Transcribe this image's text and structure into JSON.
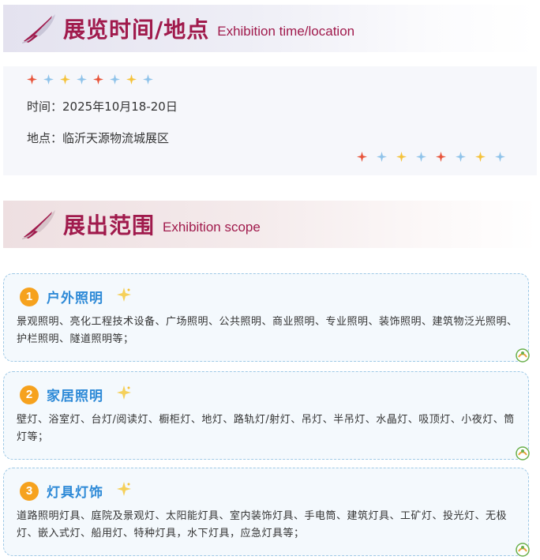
{
  "section1": {
    "title": "展览时间/地点",
    "subtitle": "Exhibition time/location"
  },
  "info": {
    "time": "时间：2025年10月18-20日",
    "place": "地点：临沂天源物流城展区"
  },
  "section2": {
    "title": "展出范围",
    "subtitle": "Exhibition scope"
  },
  "cards": [
    {
      "number": "1",
      "title": "户外照明",
      "body": "景观照明、亮化工程技术设备、广场照明、公共照明、商业照明、专业照明、装饰照明、建筑物泛光照明、护栏照明、隧道照明等；"
    },
    {
      "number": "2",
      "title": "家居照明",
      "body": "壁灯、浴室灯、台灯/阅读灯、橱柜灯、地灯、路轨灯/射灯、吊灯、半吊灯、水晶灯、吸顶灯、小夜灯、筒灯等；"
    },
    {
      "number": "3",
      "title": "灯具灯饰",
      "body": "道路照明灯具、庭院及景观灯、太阳能灯具、室内装饰灯具、手电筒、建筑灯具、工矿灯、投光灯、无极灯、嵌入式灯、船用灯、特种灯具，水下灯具，应急灯具等；"
    }
  ],
  "colors": {
    "title_red": "#a01a4c",
    "card_blue": "#2e8ad7",
    "badge_orange": "#f6a21e",
    "spark_red": "#e8543a",
    "spark_blue": "#8fc3ea",
    "spark_yellow": "#f5c23a"
  },
  "icons": [
    "brush-logo-icon",
    "sparkle-icon",
    "star-sparkle-icon",
    "small-logo-icon"
  ]
}
